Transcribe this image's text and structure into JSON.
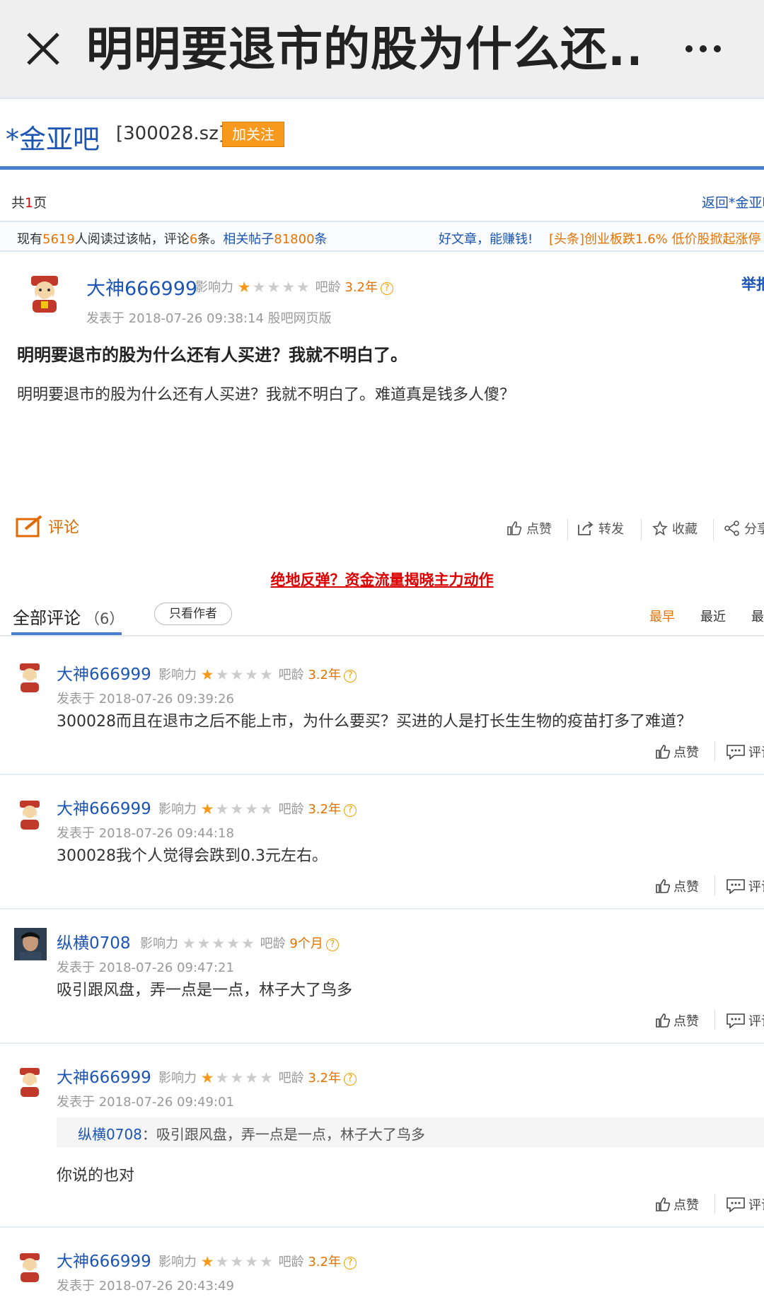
{
  "appbar": {
    "title": "明明要退市的股为什么还..."
  },
  "bar": {
    "name": "*金亚吧",
    "code": "[300028.sz]",
    "follow_label": "加关注"
  },
  "pager": {
    "prefix": "共",
    "count": "1",
    "suffix": "页",
    "back_link": "返回*金亚吧"
  },
  "stats": {
    "p1": "现有",
    "reads": "5619",
    "p2": "人阅读过该帖，评论",
    "comments": "6",
    "p3": "条。",
    "related_label": "相关帖子",
    "related": "81800",
    "p4": "条",
    "promo1": "好文章，能赚钱!",
    "promo2": "[头条]创业板跌1.6% 低价股掀起涨停"
  },
  "labels": {
    "influence": "影响力",
    "bar_age": "吧龄",
    "qmark": "?"
  },
  "post": {
    "author": "大神666999",
    "age": "3.2年",
    "report": "举报",
    "time": "发表于 2018-07-26 09:38:14 股吧网页版",
    "title": "明明要退市的股为什么还有人买进？我就不明白了。",
    "body": "明明要退市的股为什么还有人买进？我就不明白了。难道真是钱多人傻？",
    "stars_on": 1,
    "actions": {
      "reply": "评论",
      "like": "点赞",
      "forward": "转发",
      "favorite": "收藏",
      "share": "分享"
    }
  },
  "promo_link": "绝地反弹？资金流量揭晓主力动作",
  "comment_list": {
    "title": "全部评论",
    "count": "（6）",
    "only_author": "只看作者",
    "sort": [
      "最早",
      "最近",
      "最热"
    ]
  },
  "comment_actions": {
    "like": "点赞",
    "reply": "评论"
  },
  "comments": [
    {
      "author": "大神666999",
      "age": "3.2年",
      "stars_on": 1,
      "time": "发表于 2018-07-26 09:39:26",
      "text": "300028而且在退市之后不能上市，为什么要买？买进的人是打长生生物的疫苗打多了难道？"
    },
    {
      "author": "大神666999",
      "age": "3.2年",
      "stars_on": 1,
      "time": "发表于 2018-07-26 09:44:18",
      "text": "300028我个人觉得会跌到0.3元左右。"
    },
    {
      "author": "纵横0708",
      "age": "9个月",
      "stars_on": 0,
      "time": "发表于 2018-07-26 09:47:21",
      "text": "吸引跟风盘，弄一点是一点，林子大了鸟多"
    },
    {
      "author": "大神666999",
      "age": "3.2年",
      "stars_on": 1,
      "time": "发表于 2018-07-26 09:49:01",
      "quote_author": "纵横0708",
      "quote_text": "：吸引跟风盘，弄一点是一点，林子大了鸟多",
      "text": "你说的也对"
    },
    {
      "author": "大神666999",
      "age": "3.2年",
      "stars_on": 1,
      "time": "发表于 2018-07-26 20:43:49",
      "text": ""
    }
  ],
  "colors": {
    "link_blue": "#1c55b4",
    "accent_orange": "#f7991c",
    "promo_red": "#dd0000"
  }
}
